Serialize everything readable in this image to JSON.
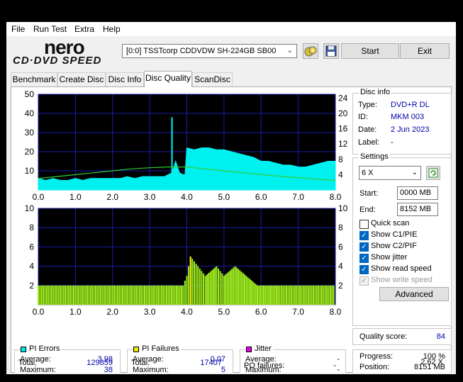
{
  "menu": [
    "File",
    "Run Test",
    "Extra",
    "Help"
  ],
  "logo": {
    "line1": "nero",
    "line2": "CD·DVD SPEED"
  },
  "drive": {
    "value": "[0:0]  TSSTcorp CDDVDW SH-224GB SB00"
  },
  "buttons": {
    "start": "Start",
    "exit": "Exit",
    "advanced": "Advanced"
  },
  "icons": {
    "eject": "eject-disc-icon",
    "save": "save-icon",
    "refresh": "refresh-icon",
    "dropdown": "chevron-down-icon"
  },
  "tabs": [
    "Benchmark",
    "Create Disc",
    "Disc Info",
    "Disc Quality",
    "ScanDisc"
  ],
  "active_tab": "Disc Quality",
  "disc_info": {
    "title": "Disc info",
    "rows": [
      {
        "label": "Type:",
        "value": "DVD+R DL"
      },
      {
        "label": "ID:",
        "value": "MKM 003"
      },
      {
        "label": "Date:",
        "value": "2 Jun 2023"
      },
      {
        "label": "Label:",
        "value": "-"
      }
    ]
  },
  "settings": {
    "title": "Settings",
    "speed": "6 X",
    "start_label": "Start:",
    "start": "0000 MB",
    "end_label": "End:",
    "end": "8152 MB",
    "checks": [
      {
        "label": "Quick scan",
        "checked": false,
        "disabled": false
      },
      {
        "label": "Show C1/PIE",
        "checked": true,
        "disabled": false
      },
      {
        "label": "Show C2/PIF",
        "checked": true,
        "disabled": false
      },
      {
        "label": "Show jitter",
        "checked": true,
        "disabled": false
      },
      {
        "label": "Show read speed",
        "checked": true,
        "disabled": false
      },
      {
        "label": "Show write speed",
        "checked": true,
        "disabled": true
      }
    ]
  },
  "quality": {
    "label": "Quality score:",
    "value": "84"
  },
  "progress": {
    "rows": [
      {
        "label": "Progress:",
        "value": "100 %"
      },
      {
        "label": "Position:",
        "value": "8151 MB"
      },
      {
        "label": "Speed:",
        "value": "2.62 X"
      }
    ]
  },
  "pi_errors": {
    "title": "PI Errors",
    "color": "#00e8e8",
    "rows": [
      {
        "label": "Average:",
        "value": "3.98"
      },
      {
        "label": "Maximum:",
        "value": "38"
      },
      {
        "label": "Total:",
        "value": "129859"
      }
    ]
  },
  "pi_failures": {
    "title": "PI Failures",
    "color": "#e8e800",
    "rows": [
      {
        "label": "Average:",
        "value": "0.07"
      },
      {
        "label": "Maximum:",
        "value": "5"
      },
      {
        "label": "Total:",
        "value": "17407"
      }
    ]
  },
  "jitter": {
    "title": "Jitter",
    "color": "#e800e8",
    "rows": [
      {
        "label": "Average:",
        "value": "-"
      },
      {
        "label": "Maximum:",
        "value": "-"
      }
    ],
    "po_label": "PO failures:",
    "po_value": "-"
  },
  "chart_data": [
    {
      "type": "area",
      "title": "PI Errors",
      "x_ticks": [
        "0.0",
        "1.0",
        "2.0",
        "3.0",
        "4.0",
        "5.0",
        "6.0",
        "7.0",
        "8.0"
      ],
      "y_left_ticks": [
        "10",
        "20",
        "30",
        "40",
        "50"
      ],
      "y_right_ticks": [
        "4",
        "8",
        "12",
        "16",
        "20",
        "24"
      ],
      "xlim": [
        0,
        8
      ],
      "ylim": [
        0,
        50
      ],
      "y2lim": [
        0,
        25
      ],
      "grid": true,
      "series": [
        {
          "values": [
            [
              0.0,
              6
            ],
            [
              0.2,
              5
            ],
            [
              0.4,
              6
            ],
            [
              0.6,
              5
            ],
            [
              0.8,
              5
            ],
            [
              1.0,
              6
            ],
            [
              1.2,
              5
            ],
            [
              1.4,
              6
            ],
            [
              1.6,
              6
            ],
            [
              1.8,
              6
            ],
            [
              2.0,
              6
            ],
            [
              2.2,
              6
            ],
            [
              2.4,
              7
            ],
            [
              2.6,
              6
            ],
            [
              2.8,
              7
            ],
            [
              3.0,
              7
            ],
            [
              3.2,
              7
            ],
            [
              3.4,
              7
            ],
            [
              3.6,
              9
            ],
            [
              3.7,
              15
            ],
            [
              3.8,
              9
            ],
            [
              3.9,
              8
            ],
            [
              3.95,
              8
            ],
            [
              4.0,
              22
            ],
            [
              4.2,
              21
            ],
            [
              4.4,
              22
            ],
            [
              4.6,
              22
            ],
            [
              4.8,
              21
            ],
            [
              5.0,
              21
            ],
            [
              5.2,
              20
            ],
            [
              5.4,
              19
            ],
            [
              5.6,
              18
            ],
            [
              5.8,
              17
            ],
            [
              6.0,
              15
            ],
            [
              6.2,
              15
            ],
            [
              6.4,
              14
            ],
            [
              6.6,
              13
            ],
            [
              6.8,
              13
            ],
            [
              7.0,
              12
            ],
            [
              7.2,
              12
            ],
            [
              7.4,
              13
            ],
            [
              7.6,
              14
            ],
            [
              7.8,
              15
            ],
            [
              8.0,
              15
            ]
          ]
        },
        {
          "values": [
            [
              0.0,
              3
            ],
            [
              0.5,
              3.5
            ],
            [
              1.0,
              4
            ],
            [
              1.5,
              4.5
            ],
            [
              2.0,
              5
            ],
            [
              2.5,
              5.5
            ],
            [
              3.0,
              5.8
            ],
            [
              3.5,
              6
            ],
            [
              4.0,
              6
            ],
            [
              4.5,
              5.5
            ],
            [
              5.0,
              5
            ],
            [
              5.5,
              4.5
            ],
            [
              6.0,
              4
            ],
            [
              6.5,
              3.6
            ],
            [
              7.0,
              3.2
            ],
            [
              7.5,
              2.8
            ],
            [
              8.0,
              2.5
            ]
          ]
        }
      ]
    },
    {
      "type": "bar",
      "title": "PI Failures",
      "x_ticks": [
        "0.0",
        "1.0",
        "2.0",
        "3.0",
        "4.0",
        "5.0",
        "6.0",
        "7.0",
        "8.0"
      ],
      "y_left_ticks": [
        "2",
        "4",
        "6",
        "8",
        "10"
      ],
      "y_right_ticks": [
        "2",
        "4",
        "6",
        "8",
        "10"
      ],
      "xlim": [
        0,
        8
      ],
      "ylim": [
        0,
        10
      ],
      "grid": true,
      "series": [
        {
          "values": [
            [
              0.0,
              2
            ],
            [
              0.5,
              2
            ],
            [
              1.0,
              2
            ],
            [
              1.5,
              2
            ],
            [
              2.0,
              2
            ],
            [
              2.5,
              2
            ],
            [
              3.0,
              2
            ],
            [
              3.5,
              2
            ],
            [
              3.9,
              2
            ],
            [
              4.0,
              3
            ],
            [
              4.1,
              5
            ],
            [
              4.3,
              4
            ],
            [
              4.5,
              3
            ],
            [
              4.8,
              4
            ],
            [
              5.0,
              3
            ],
            [
              5.3,
              4
            ],
            [
              5.6,
              3
            ],
            [
              5.9,
              2
            ],
            [
              6.2,
              2
            ],
            [
              6.5,
              2
            ],
            [
              7.0,
              2
            ],
            [
              7.5,
              2
            ],
            [
              8.0,
              2
            ]
          ]
        }
      ]
    }
  ]
}
